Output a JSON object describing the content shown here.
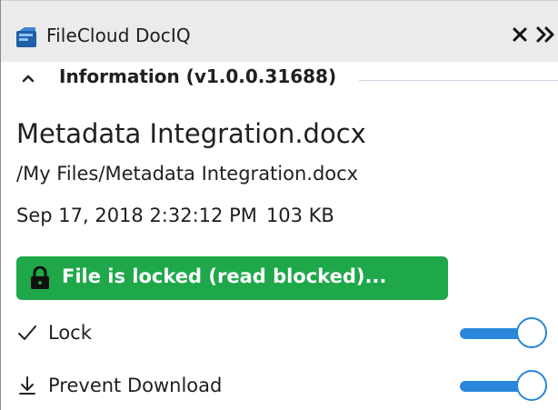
{
  "window": {
    "title": "FileCloud DocIQ",
    "icons": {
      "logo": "filecloud-logo-icon",
      "close": "close-icon",
      "expand": "double-chevron-right-icon"
    }
  },
  "section": {
    "title": "Information (v1.0.0.31688)",
    "icon": "chevron-up-icon"
  },
  "file": {
    "name": "Metadata Integration.docx",
    "path": "/My Files/Metadata Integration.docx",
    "date": "Sep 17, 2018 2:32:12 PM",
    "size": "103 KB"
  },
  "lock_status": {
    "label": "File is locked (read blocked)...",
    "icon": "padlock-icon",
    "color": "#1fa84a"
  },
  "options": [
    {
      "label": "Lock",
      "icon": "checkmark-icon",
      "enabled": true
    },
    {
      "label": "Prevent Download",
      "icon": "download-icon",
      "enabled": true
    }
  ],
  "colors": {
    "accent": "#2a86d8",
    "titlebar": "#ebebeb"
  }
}
